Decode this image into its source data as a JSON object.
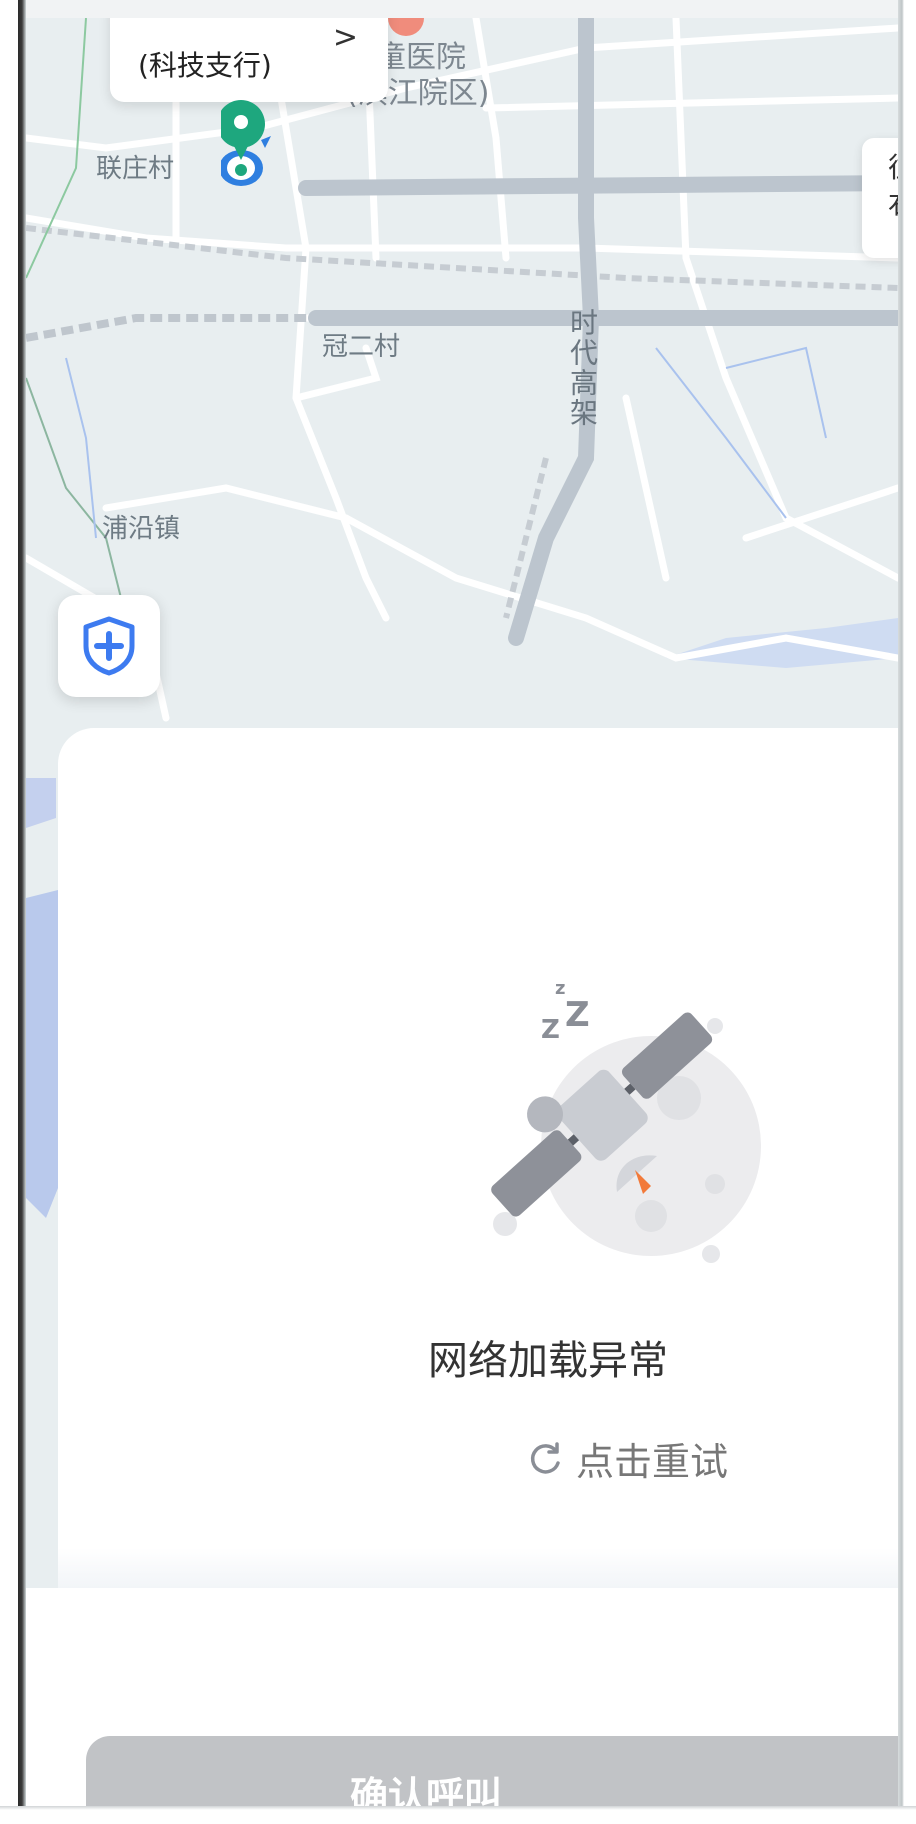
{
  "map": {
    "labels": {
      "lianzhuang": "联庄村",
      "guaner": "冠二村",
      "pu_yan": "浦沿镇",
      "shidai": "时代高架",
      "hospital": "儿童医院(滨江院区)"
    },
    "location_card": {
      "subtitle": "(科技支行)",
      "chevron": ">"
    },
    "side_chip_text": "往右"
  },
  "shield_button": {
    "icon": "shield-plus-icon"
  },
  "error": {
    "message": "网络加载异常",
    "retry_label": "点击重试",
    "retry_icon": "refresh-icon",
    "illustration": "sleeping-satellite-icon"
  },
  "confirm_button": {
    "label": "确认呼叫"
  },
  "colors": {
    "pin_green": "#1ea77e",
    "shield_blue": "#3d7bf0",
    "button_disabled": "#c1c3c6",
    "accent_orange": "#f27a3a"
  }
}
